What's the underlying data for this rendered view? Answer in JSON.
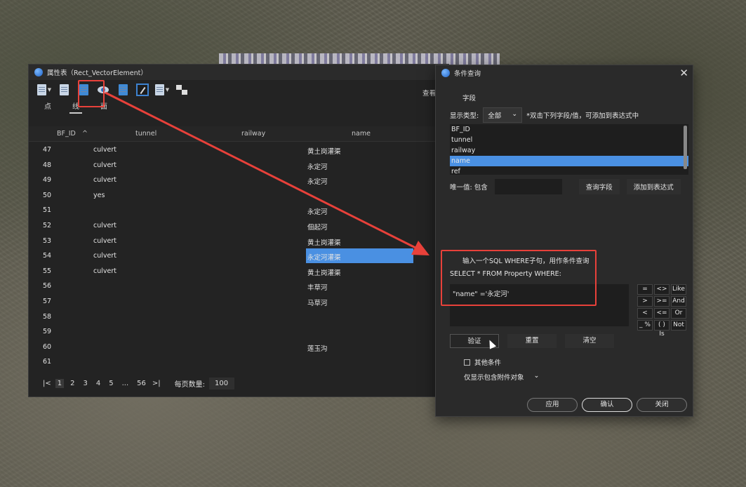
{
  "attr_window": {
    "title": "属性表（Rect_VectorElement）",
    "view_button": "查看",
    "tabs": [
      "点",
      "线",
      "面"
    ],
    "columns": [
      "BF_ID",
      "tunnel",
      "railway",
      "name"
    ],
    "rows": [
      {
        "id": "47",
        "tunnel": "culvert",
        "name": "黄土岗灌渠"
      },
      {
        "id": "48",
        "tunnel": "culvert",
        "name": "永定河"
      },
      {
        "id": "49",
        "tunnel": "culvert",
        "name": "永定河"
      },
      {
        "id": "50",
        "tunnel": "yes",
        "name": ""
      },
      {
        "id": "51",
        "tunnel": "",
        "name": "永定河"
      },
      {
        "id": "52",
        "tunnel": "culvert",
        "name": "佃起河"
      },
      {
        "id": "53",
        "tunnel": "culvert",
        "name": "黄土岗灌渠"
      },
      {
        "id": "54",
        "tunnel": "culvert",
        "name": "永定河灌渠"
      },
      {
        "id": "55",
        "tunnel": "culvert",
        "name": "黄土岗灌渠"
      },
      {
        "id": "56",
        "tunnel": "",
        "name": "丰草河"
      },
      {
        "id": "57",
        "tunnel": "",
        "name": "马草河"
      },
      {
        "id": "58",
        "tunnel": "",
        "name": ""
      },
      {
        "id": "59",
        "tunnel": "",
        "name": ""
      },
      {
        "id": "60",
        "tunnel": "",
        "name": "莲玉沟"
      },
      {
        "id": "61",
        "tunnel": "",
        "name": ""
      }
    ],
    "pager": {
      "first": "|<",
      "pages": [
        "1",
        "2",
        "3",
        "4",
        "5",
        "...",
        "56"
      ],
      "last": ">|",
      "per_page_label": "每页数量:",
      "per_page_value": "100"
    }
  },
  "dialog": {
    "title": "条件查询",
    "close": "✕",
    "field_section": "字段",
    "display_type_label": "显示类型:",
    "display_type_value": "全部",
    "double_click_hint": "*双击下列字段/值，可添加到表达式中",
    "fields": [
      "BF_ID",
      "tunnel",
      "railway",
      "name",
      "ref"
    ],
    "unique_label": "唯一值: 包含",
    "query_field_btn": "查询字段",
    "add_expr_btn": "添加到表达式",
    "sql_hint": "输入一个SQL WHERE子句，用作条件查询",
    "sql_prefix": "SELECT * FROM Property WHERE:",
    "sql_text": "\"name\" ='永定河'",
    "operators": [
      "=",
      "<>",
      "Like",
      ">",
      ">=",
      "And",
      "<",
      "<=",
      "Or",
      "_ %",
      "( ) Is",
      "Not"
    ],
    "validate_btn": "验证",
    "reset_btn": "重置",
    "clear_btn": "清空",
    "other_conditions": "其他条件",
    "sub_option": "仅显示包含附件对象",
    "apply_btn": "应用",
    "ok_btn": "确认",
    "close_btn": "关闭"
  },
  "colors": {
    "annotation": "#e8413a",
    "selection": "#4a90e2"
  }
}
